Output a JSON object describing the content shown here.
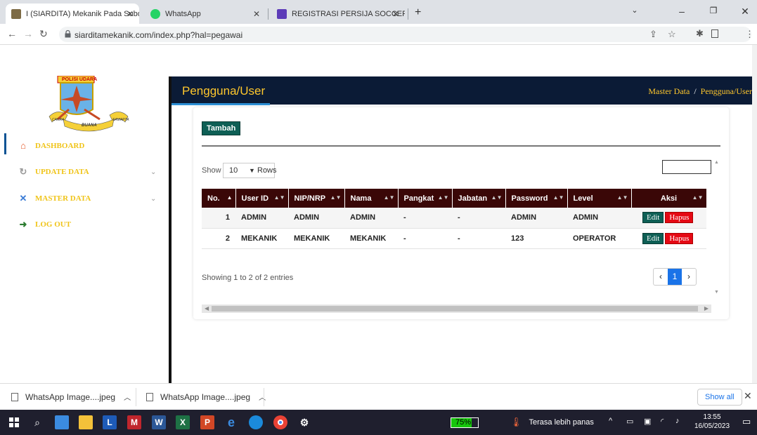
{
  "browser": {
    "tabs": [
      {
        "title": "I (SIARDITA) Mekanik Pada Subd",
        "active": true
      },
      {
        "title": "WhatsApp",
        "active": false
      },
      {
        "title": "REGISTRASI PERSIJA SOCCER SC",
        "active": false
      }
    ],
    "new_tab": "+",
    "url": "siarditamekanik.com/index.php?hal=pegawai",
    "profile_initial": "D"
  },
  "sidebar": {
    "logo_text_top": "POLISI UDARA",
    "logo_text_bottom": "BUANA",
    "logo_text_left": "CAKRA",
    "logo_text_right": "SAMAPTA",
    "items": [
      {
        "label": "DASHBOARD",
        "icon": "home-icon"
      },
      {
        "label": "UPDATE DATA",
        "icon": "update-icon"
      },
      {
        "label": "MASTER DATA",
        "icon": "tools-icon"
      },
      {
        "label": "LOG OUT",
        "icon": "logout-icon"
      }
    ]
  },
  "header": {
    "title": "Pengguna/User",
    "breadcrumb": [
      "Master Data",
      "Pengguna/User"
    ],
    "breadcrumb_sep": "/"
  },
  "card": {
    "add_button": "Tambah",
    "show_label": "Show",
    "rows_value": "10",
    "rows_label": "Rows",
    "columns": [
      "No.",
      "User ID",
      "NIP/NRP",
      "Nama",
      "Pangkat",
      "Jabatan",
      "Password",
      "Level",
      "Aksi"
    ],
    "rows": [
      {
        "no": "1",
        "user_id": "ADMIN",
        "nip": "ADMIN",
        "nama": "ADMIN",
        "pangkat": "-",
        "jabatan": "-",
        "password": "ADMIN",
        "level": "ADMIN"
      },
      {
        "no": "2",
        "user_id": "MEKANIK",
        "nip": "MEKANIK",
        "nama": "MEKANIK",
        "pangkat": "-",
        "jabatan": "-",
        "password": "123",
        "level": "OPERATOR"
      }
    ],
    "edit_label": "Edit",
    "delete_label": "Hapus",
    "info": "Showing 1 to 2 of 2 entries",
    "pager_prev": "‹",
    "pager_current": "1",
    "pager_next": "›"
  },
  "downloads": {
    "items": [
      "WhatsApp Image....jpeg",
      "WhatsApp Image....jpeg"
    ],
    "show_all": "Show all"
  },
  "taskbar": {
    "battery": "75%",
    "battery_level": 0.75,
    "weather": "Terasa lebih panas",
    "time": "13:55",
    "date": "16/05/2023"
  },
  "colors": {
    "header_bg": "#0b1b36",
    "accent_yellow": "#ffc72c",
    "table_header": "#3a0707",
    "button_green": "#0e5f55",
    "button_red": "#e50914"
  }
}
